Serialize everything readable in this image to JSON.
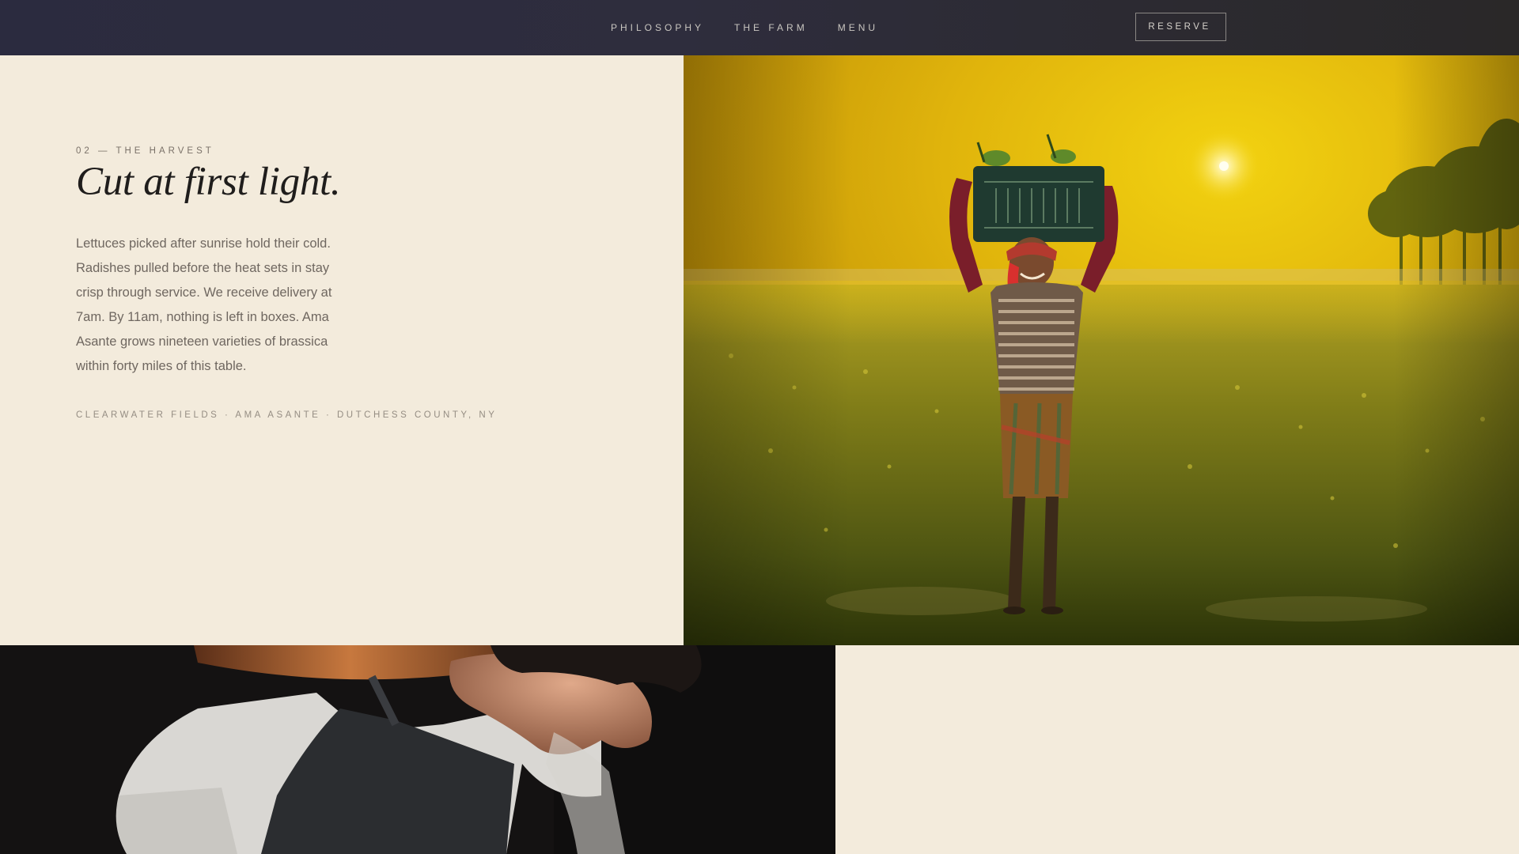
{
  "nav": {
    "links": [
      "PHILOSOPHY",
      "THE FARM",
      "MENU"
    ],
    "reserve_label": "RESERVE"
  },
  "intro": {
    "eyebrow": "02 — THE HARVEST",
    "headline": "Cut at first light.",
    "body": "Lettuces picked after sunrise hold their cold. Radishes pulled before the heat sets in stay crisp through service. We receive delivery at 7am. By 11am, nothing is left in boxes. Ama Asante grows nineteen varieties of brassica within forty miles of this table.",
    "credits": "CLEARWATER FIELDS · AMA ASANTE · DUTCHESS COUNTY, NY"
  },
  "colors": {
    "nav_bg": "#2b2b3f",
    "page_bg": "#f3ebdc",
    "headline": "#1f1d1c",
    "body_text": "#6f6760"
  }
}
